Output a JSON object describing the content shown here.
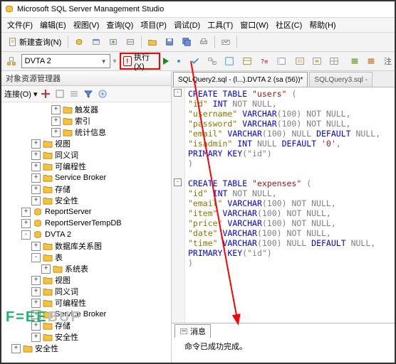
{
  "title": "Microsoft SQL Server Management Studio",
  "menu": {
    "file": "文件(F)",
    "edit": "编辑(E)",
    "view": "视图(V)",
    "query": "查询(Q)",
    "project": "项目(P)",
    "debug": "调试(D)",
    "tools": "工具(T)",
    "window": "窗口(W)",
    "community": "社区(C)",
    "help": "帮助(H)"
  },
  "toolbar": {
    "new_query": "新建查询(N)"
  },
  "secondbar": {
    "db": "DVTA 2",
    "execute": "执行(X)",
    "extra": "注"
  },
  "objexp": {
    "title": "对象资源管理器",
    "connect": "连接(O)",
    "tree": [
      {
        "d": 5,
        "tw": "+",
        "icon": "folder",
        "label": "触发器"
      },
      {
        "d": 5,
        "tw": "+",
        "icon": "folder",
        "label": "索引"
      },
      {
        "d": 5,
        "tw": "+",
        "icon": "folder",
        "label": "统计信息"
      },
      {
        "d": 3,
        "tw": "+",
        "icon": "folder",
        "label": "视图"
      },
      {
        "d": 3,
        "tw": "+",
        "icon": "folder",
        "label": "同义词"
      },
      {
        "d": 3,
        "tw": "+",
        "icon": "folder",
        "label": "可编程性"
      },
      {
        "d": 3,
        "tw": "+",
        "icon": "folder",
        "label": "Service Broker"
      },
      {
        "d": 3,
        "tw": "+",
        "icon": "folder",
        "label": "存储"
      },
      {
        "d": 3,
        "tw": "+",
        "icon": "folder",
        "label": "安全性"
      },
      {
        "d": 2,
        "tw": "+",
        "icon": "db",
        "label": "ReportServer"
      },
      {
        "d": 2,
        "tw": "+",
        "icon": "db",
        "label": "ReportServerTempDB"
      },
      {
        "d": 2,
        "tw": "-",
        "icon": "db",
        "label": "DVTA 2"
      },
      {
        "d": 3,
        "tw": "+",
        "icon": "folder",
        "label": "数据库关系图"
      },
      {
        "d": 3,
        "tw": "-",
        "icon": "folder",
        "label": "表"
      },
      {
        "d": 4,
        "tw": "+",
        "icon": "folder",
        "label": "系统表"
      },
      {
        "d": 3,
        "tw": "+",
        "icon": "folder",
        "label": "视图"
      },
      {
        "d": 3,
        "tw": "+",
        "icon": "folder",
        "label": "同义词"
      },
      {
        "d": 3,
        "tw": "+",
        "icon": "folder",
        "label": "可编程性"
      },
      {
        "d": 3,
        "tw": "+",
        "icon": "folder",
        "label": "Service Broker"
      },
      {
        "d": 3,
        "tw": "+",
        "icon": "folder",
        "label": "存储"
      },
      {
        "d": 3,
        "tw": "+",
        "icon": "folder",
        "label": "安全性"
      },
      {
        "d": 1,
        "tw": "+",
        "icon": "folder",
        "label": "安全性"
      }
    ]
  },
  "tabs": [
    {
      "label": "SQLQuery2.sql - (l...).DVTA 2 (sa (56))*",
      "active": true
    },
    {
      "label": "SQLQuery3.sql -",
      "active": false
    }
  ],
  "msg": {
    "tab": "消息",
    "text": "命令已成功完成。"
  },
  "code_users": {
    "create": "CREATE TABLE",
    "name": "\"users\"",
    "l1a": "\"id\"",
    "l1b": "INT",
    "l1c": "NOT NULL",
    "l2a": "\"username\"",
    "l2b": "VARCHAR",
    "l2p": "(100)",
    "l2c": "NOT NULL",
    "l3a": "\"password\"",
    "l3b": "VARCHAR",
    "l3p": "(100)",
    "l3c": "NOT NULL",
    "l4a": "\"email\"",
    "l4b": "VARCHAR",
    "l4p": "(100)",
    "l4c": "NULL",
    "l4d": "DEFAULT",
    "l4e": "NULL",
    "l5a": "\"isadmin\"",
    "l5b": "INT",
    "l5c": "NULL",
    "l5d": "DEFAULT",
    "l5e": "'0'",
    "pk": "PRIMARY KEY",
    "pkv": "(\"id\")"
  },
  "code_exp": {
    "create": "CREATE TABLE",
    "name": "\"expenses\"",
    "l1a": "\"id\"",
    "l1b": "INT",
    "l1c": "NOT NULL",
    "l2a": "\"email\"",
    "l2b": "VARCHAR",
    "l2p": "(100)",
    "l2c": "NOT NULL",
    "l3a": "\"item\"",
    "l3b": "VARCHAR",
    "l3p": "(100)",
    "l3c": "NOT NULL",
    "l4a": "\"price\"",
    "l4b": "VARCHAR",
    "l4p": "(100)",
    "l4c": "NOT NULL",
    "l5a": "\"date\"",
    "l5b": "VARCHAR",
    "l5p": "(100)",
    "l5c": "NOT NULL",
    "l6a": "\"time\"",
    "l6b": "VARCHAR",
    "l6p": "(100)",
    "l6c": "NULL",
    "l6d": "DEFAULT",
    "l6e": "NULL",
    "pk": "PRIMARY KEY",
    "pkv": "(\"id\")"
  },
  "watermark": {
    "a": "F=EE",
    "b": "BUF"
  }
}
